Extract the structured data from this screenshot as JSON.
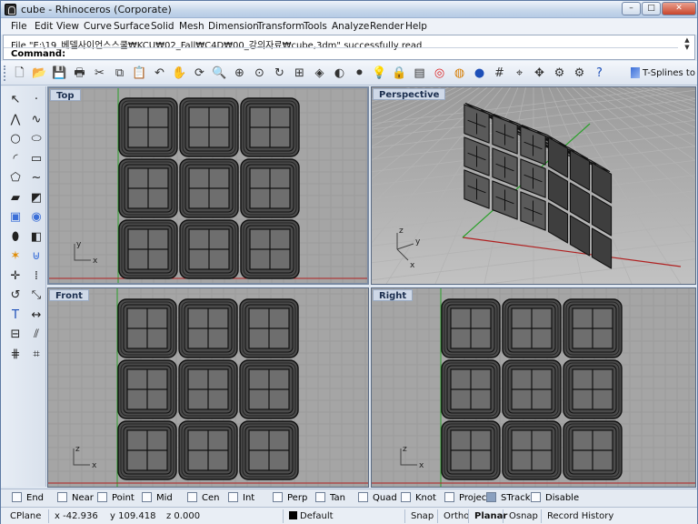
{
  "window": {
    "title": "cube - Rhinoceros (Corporate)",
    "minimize_glyph": "–",
    "maximize_glyph": "□",
    "close_glyph": "✕"
  },
  "menu": [
    "File",
    "Edit",
    "View",
    "Curve",
    "Surface",
    "Solid",
    "Mesh",
    "Dimension",
    "Transform",
    "Tools",
    "Analyze",
    "Render",
    "Help"
  ],
  "command": {
    "history": "File \"E:\\19_베델사이언스스쿨₩KCU₩02_Fall₩C4D₩00_강의자료₩cube,3dm\" successfully read",
    "prompt": "Command:",
    "value": ""
  },
  "toolbar_icons": [
    "new-file",
    "open-folder",
    "save",
    "print",
    "cut",
    "copy",
    "paste",
    "undo",
    "pan-hand",
    "rotate-view",
    "zoom-window",
    "zoom-extents",
    "zoom-selected",
    "rotate-3d",
    "viewport-layout",
    "wireframe",
    "shaded",
    "rendered",
    "light",
    "lock",
    "layer",
    "color-wheel",
    "material",
    "render-sphere",
    "grid",
    "object-snap",
    "gumball",
    "settings-gears",
    "plugin",
    "help"
  ],
  "tsplines_label": "T-Splines to",
  "left_toolbar_icons": [
    "select",
    "point",
    "polyline",
    "curve",
    "circle",
    "ellipse",
    "arc",
    "rectangle",
    "polygon",
    "free-curve",
    "surface",
    "surface-edit",
    "box-solid",
    "sphere",
    "cylinder",
    "solid-edit",
    "explode",
    "boolean",
    "transform-move",
    "array",
    "rotate",
    "scale",
    "text",
    "dimension",
    "group",
    "split",
    "mesh",
    "analyze"
  ],
  "viewports": [
    {
      "id": "top",
      "label": "Top"
    },
    {
      "id": "perspective",
      "label": "Perspective"
    },
    {
      "id": "front",
      "label": "Front"
    },
    {
      "id": "right",
      "label": "Right"
    }
  ],
  "axis_labels": {
    "x": "x",
    "y": "y",
    "z": "z"
  },
  "osnaps": [
    {
      "label": "End",
      "checked": false
    },
    {
      "label": "Near",
      "checked": false
    },
    {
      "label": "Point",
      "checked": false
    },
    {
      "label": "Mid",
      "checked": false
    },
    {
      "label": "Cen",
      "checked": false
    },
    {
      "label": "Int",
      "checked": false
    },
    {
      "label": "Perp",
      "checked": false
    },
    {
      "label": "Tan",
      "checked": false
    },
    {
      "label": "Quad",
      "checked": false
    },
    {
      "label": "Knot",
      "checked": false
    },
    {
      "label": "Project",
      "checked": false
    },
    {
      "label": "STrack",
      "checked": true
    },
    {
      "label": "Disable",
      "checked": false
    }
  ],
  "status": {
    "cplane": "CPlane",
    "x": "x -42.936",
    "y": "y 109.418",
    "z": "z 0.000",
    "layer": "Default",
    "snap": "Snap",
    "ortho": "Ortho",
    "planar": "Planar",
    "osnap": "Osnap",
    "record": "Record History"
  },
  "colors": {
    "viewport_bg": "#a5a5a5",
    "grid_minor": "#9c9c9c",
    "grid_major": "#8a8a8a",
    "x_axis": "#b02020",
    "y_axis": "#2aa02a",
    "label_bg": "#cfd9e8"
  }
}
